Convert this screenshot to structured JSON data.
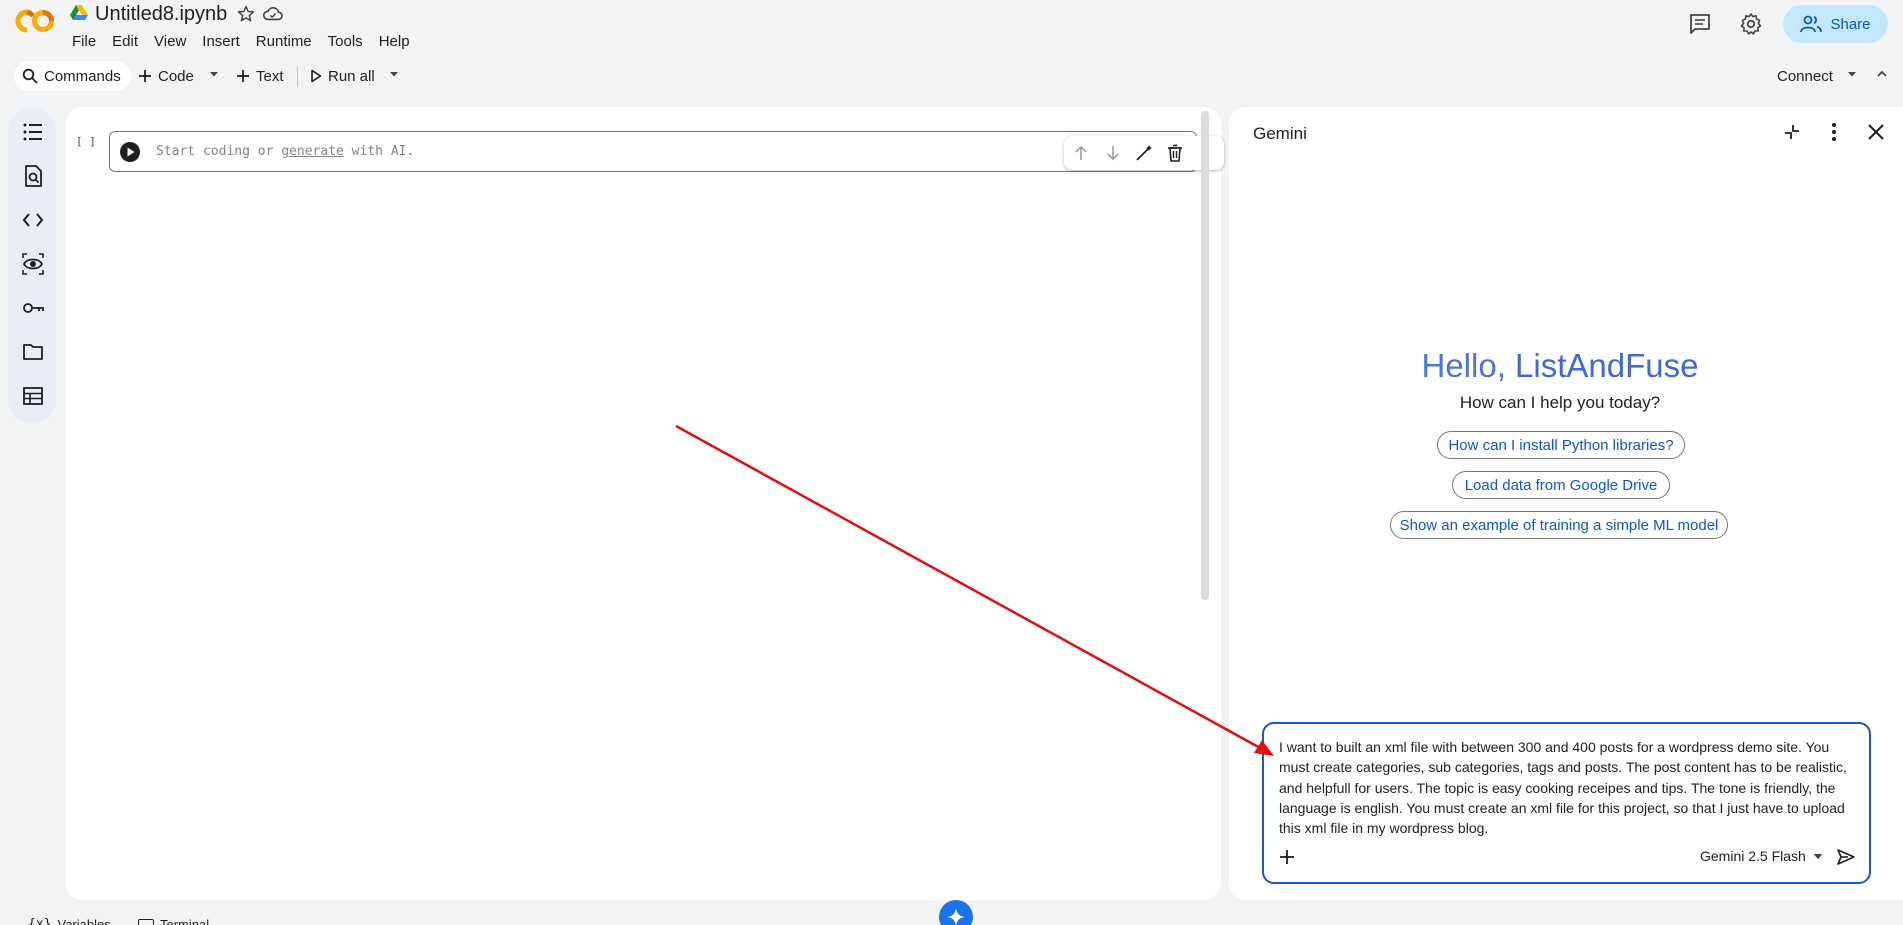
{
  "header": {
    "title": "Untitled8.ipynb",
    "menu": [
      "File",
      "Edit",
      "View",
      "Insert",
      "Runtime",
      "Tools",
      "Help"
    ],
    "share_label": "Share"
  },
  "toolbar": {
    "commands_label": "Commands",
    "code_label": "Code",
    "text_label": "Text",
    "run_all_label": "Run all",
    "connect_label": "Connect"
  },
  "sidebar": {
    "icons": [
      "table-of-contents-icon",
      "find-replace-icon",
      "code-snippets-icon",
      "variable-inspector-icon",
      "secrets-key-icon",
      "files-folder-icon",
      "data-table-icon"
    ]
  },
  "cell": {
    "bracket": "[ ]",
    "placeholder_before": "Start coding or ",
    "placeholder_link": "generate",
    "placeholder_after": " with AI."
  },
  "gemini": {
    "title": "Gemini",
    "greeting_prefix": "Hello, ",
    "greeting_name": "ListAndFuse",
    "subtitle": "How can I help you today?",
    "suggestions": [
      "How can I install Python libraries?",
      "Load data from Google Drive",
      "Show an example of training a simple ML model"
    ],
    "prompt_text": "I want to built an xml file with between 300 and 400 posts for a wordpress demo site. You must create categories, sub categories, tags and posts. The post content has to be realistic, and helpfull for users. The topic is easy cooking receipes and tips. The tone is friendly, the language is english. You must create an xml file for this project, so that I just have to upload this xml file in my wordpress blog.",
    "model_label": "Gemini 2.5 Flash"
  },
  "bottom": {
    "variables_label": "Variables",
    "terminal_label": "Terminal"
  },
  "colors": {
    "accent": "#0b57d0",
    "share_bg": "#c2e7ff",
    "annotation": "#e01010",
    "greeting": "#4a76d9"
  }
}
